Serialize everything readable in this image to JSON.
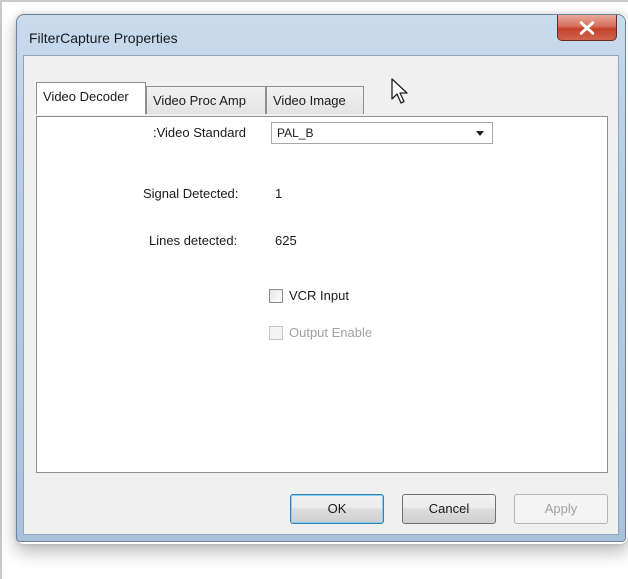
{
  "window": {
    "title": "FilterCapture Properties",
    "close_icon": "close-x-icon",
    "close_color": "#c4412a"
  },
  "tabs": [
    {
      "label": "Video Decoder",
      "active": true
    },
    {
      "label": "Video Proc Amp",
      "active": false
    },
    {
      "label": "Video Image",
      "active": false
    }
  ],
  "panel": {
    "video_standard": {
      "label": ":Video Standard",
      "selected": "PAL_B",
      "icon": "dropdown-arrow-icon"
    },
    "signal_detected": {
      "label": "Signal Detected:",
      "value": "1"
    },
    "lines_detected": {
      "label": "Lines detected:",
      "value": "625"
    },
    "vcr_input": {
      "label": "VCR Input",
      "checked": false,
      "enabled": true
    },
    "output_enable": {
      "label": "Output Enable",
      "checked": false,
      "enabled": false
    }
  },
  "buttons": {
    "ok": "OK",
    "cancel": "Cancel",
    "apply": "Apply"
  },
  "colors": {
    "title_bar": "#b6cde6",
    "client_bg": "#f0f0f0",
    "default_button_border": "#3c7fb1"
  },
  "cursor_icon": "mouse-pointer-icon"
}
